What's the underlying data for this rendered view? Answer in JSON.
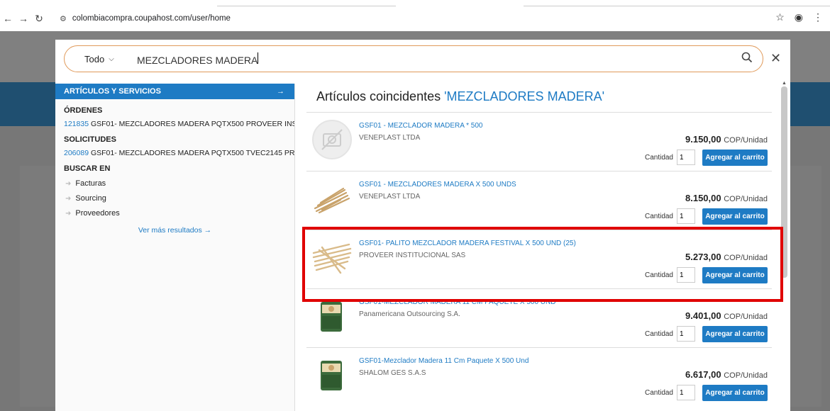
{
  "browser": {
    "url": "colombiacompra.coupahost.com/user/home"
  },
  "search": {
    "category": "Todo",
    "query": "MEZCLADORES MADERA"
  },
  "left_panel": {
    "header": "ARTÍCULOS Y SERVICIOS",
    "header_arrow": "→",
    "orders_title": "ÓRDENES",
    "order_id": "121835",
    "order_text": "GSF01- MEZCLADORES MADERA PQTX500 PROVEER INS...",
    "requests_title": "SOLICITUDES",
    "request_id": "206089",
    "request_text": "GSF01- MEZCLADORES MADERA PQTX500 TVEC2145 PR...",
    "search_in_title": "BUSCAR EN",
    "search_in": [
      {
        "label": "Facturas"
      },
      {
        "label": "Sourcing"
      },
      {
        "label": "Proveedores"
      }
    ],
    "more_results": "Ver más resultados →"
  },
  "results": {
    "title": "Artículos coincidentes",
    "query_label": "'MEZCLADORES MADERA'",
    "qty_label": "Cantidad",
    "add_label": "Agregar al carrito",
    "unit_label": "COP/Unidad",
    "items": [
      {
        "name": "GSF01 - MEZCLADOR MADERA * 500",
        "supplier": "VENEPLAST LTDA",
        "price": "9.150,00",
        "qty": "1",
        "image": "no-image-icon"
      },
      {
        "name": "GSF01 - MEZCLADORES MADERA X 500 UNDS",
        "supplier": "VENEPLAST LTDA",
        "price": "8.150,00",
        "qty": "1",
        "image": "wooden-sticks-image"
      },
      {
        "name": "GSF01- PALITO MEZCLADOR MADERA FESTIVAL X 500 UND (25)",
        "supplier": "PROVEER INSTITUCIONAL SAS",
        "price": "5.273,00",
        "qty": "1",
        "image": "wooden-sticks-image"
      },
      {
        "name": "GSF01-MEZCLADOR MADERA 11 CM PAQUETE X 500 UND",
        "supplier": "Panamericana Outsourcing S.A.",
        "price": "9.401,00",
        "qty": "1",
        "image": "package-image"
      },
      {
        "name": "GSF01-Mezclador Madera 11 Cm Paquete X 500 Und",
        "supplier": "SHALOM GES S.A.S",
        "price": "6.617,00",
        "qty": "1",
        "image": "package-image"
      }
    ]
  },
  "colors": {
    "accent": "#1e7bc4",
    "highlight": "#e00000",
    "search_border": "#e09a5a"
  }
}
